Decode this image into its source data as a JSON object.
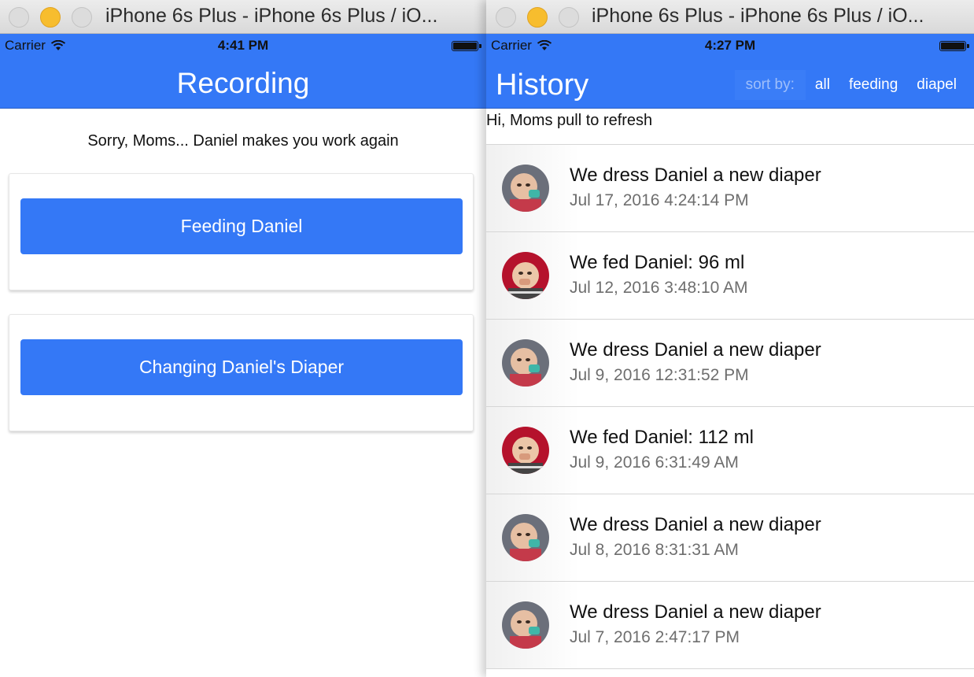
{
  "left_window": {
    "title": "iPhone 6s Plus - iPhone 6s Plus / iO...",
    "status": {
      "carrier": "Carrier",
      "time": "4:41 PM"
    },
    "nav_title": "Recording",
    "intro": "Sorry, Moms... Daniel makes you work again",
    "buttons": {
      "feeding": "Feeding Daniel",
      "diaper": "Changing Daniel's Diaper"
    }
  },
  "right_window": {
    "title": "iPhone 6s Plus - iPhone 6s Plus / iO...",
    "status": {
      "carrier": "Carrier",
      "time": "4:27 PM"
    },
    "nav_title": "History",
    "sort": {
      "label": "sort by:",
      "options": [
        "all",
        "feeding",
        "diapel"
      ]
    },
    "refresh_hint": "Hi, Moms pull to refresh",
    "items": [
      {
        "title": "We dress Daniel a new diaper",
        "date": "Jul 17, 2016 4:24:14 PM",
        "avatar": "diaper-photo"
      },
      {
        "title": "We fed Daniel: 96 ml",
        "date": "Jul 12, 2016 3:48:10 AM",
        "avatar": "feeding-photo"
      },
      {
        "title": "We dress Daniel a new diaper",
        "date": "Jul 9, 2016 12:31:52 PM",
        "avatar": "diaper-photo"
      },
      {
        "title": "We fed Daniel: 112 ml",
        "date": "Jul 9, 2016 6:31:49 AM",
        "avatar": "feeding-photo"
      },
      {
        "title": "We dress Daniel a new diaper",
        "date": "Jul 8, 2016 8:31:31 AM",
        "avatar": "diaper-photo"
      },
      {
        "title": "We dress Daniel a new diaper",
        "date": "Jul 7, 2016 2:47:17 PM",
        "avatar": "diaper-photo"
      }
    ]
  },
  "colors": {
    "accent": "#3478f6",
    "minimize": "#f7bd2e"
  },
  "icons": {
    "wifi": "wifi-icon",
    "battery": "battery-icon"
  }
}
